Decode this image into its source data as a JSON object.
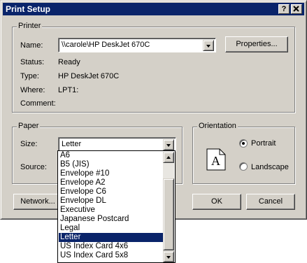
{
  "window": {
    "title": "Print Setup",
    "help_label": "?",
    "close_label": "X"
  },
  "printer": {
    "group_label": "Printer",
    "name_label": "Name:",
    "name_value": "\\\\carole\\HP DeskJet 670C",
    "properties_label": "Properties...",
    "status_label": "Status:",
    "status_value": "Ready",
    "type_label": "Type:",
    "type_value": "HP DeskJet 670C",
    "where_label": "Where:",
    "where_value": "LPT1:",
    "comment_label": "Comment:",
    "comment_value": ""
  },
  "paper": {
    "group_label": "Paper",
    "size_label": "Size:",
    "size_value": "Letter",
    "source_label": "Source:",
    "size_options": [
      "A6",
      "B5 (JIS)",
      "Envelope #10",
      "Envelope A2",
      "Envelope C6",
      "Envelope DL",
      "Executive",
      "Japanese Postcard",
      "Legal",
      "Letter",
      "US Index Card 4x6",
      "US Index Card 5x8"
    ],
    "selected_option": "Letter"
  },
  "orientation": {
    "group_label": "Orientation",
    "preview_letter": "A",
    "portrait_label": "Portrait",
    "landscape_label": "Landscape",
    "selected": "Portrait"
  },
  "buttons": {
    "network_label": "Network...",
    "ok_label": "OK",
    "cancel_label": "Cancel"
  },
  "colors": {
    "title_bar": "#0a246a",
    "face": "#d4d0c8",
    "selection": "#0a246a"
  }
}
